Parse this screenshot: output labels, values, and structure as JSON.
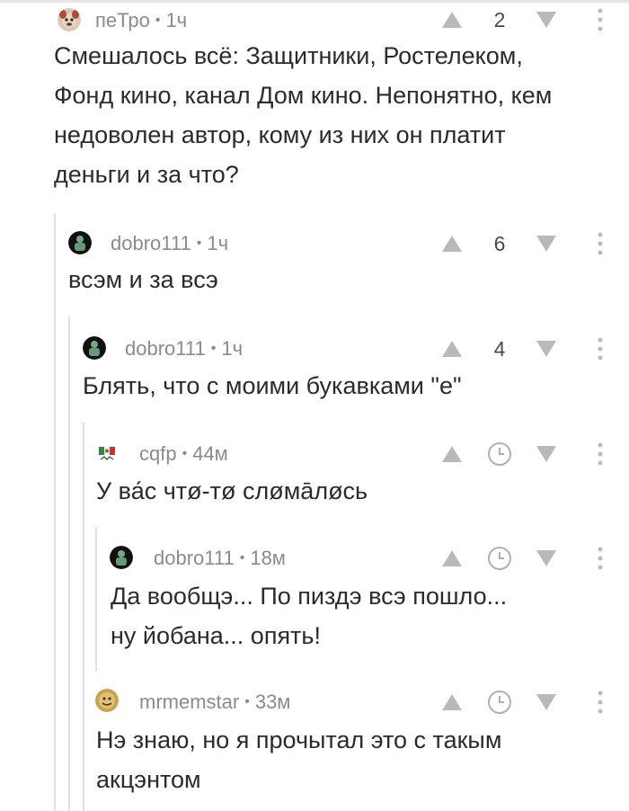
{
  "comments": [
    {
      "author": "пеТро",
      "time": "1ч",
      "rating": "2",
      "lines": [
        "Смешалось всё: Защитники, Ростелеком,",
        "Фонд кино, канал Дом кино. Непонятно, кем",
        "недоволен автор, кому из них он платит",
        "деньги и за что?"
      ]
    },
    {
      "author": "dobro111",
      "time": "1ч",
      "rating": "6",
      "lines": [
        "всэм и за всэ"
      ]
    },
    {
      "author": "dobro111",
      "time": "1ч",
      "rating": "4",
      "lines": [
        "Блять, что с моими букавками \"е\""
      ]
    },
    {
      "author": "cqfp",
      "time": "44м",
      "rating": "",
      "lines": [
        "У ва́с чтø-тø слøма̄лøсь"
      ]
    },
    {
      "author": "dobro111",
      "time": "18м",
      "rating": "",
      "lines": [
        "Да вообщэ... По пиздэ всэ пошло...",
        "ну йобана... опять!"
      ]
    },
    {
      "author": "mrmemstar",
      "time": "33м",
      "rating": "",
      "lines": [
        "Нэ знаю, но я прочытал это с такым",
        "акцэнтом"
      ]
    }
  ],
  "separator": "•",
  "icons": {
    "upvote": "arrow-up-icon",
    "downvote": "arrow-down-icon",
    "pending": "clock-icon",
    "more": "more-vertical-icon"
  },
  "colors": {
    "meta": "#8b8b8b",
    "arrow": "#b9b9b9",
    "thread_line": "#e1e1e1",
    "text": "#2b2b2b"
  }
}
